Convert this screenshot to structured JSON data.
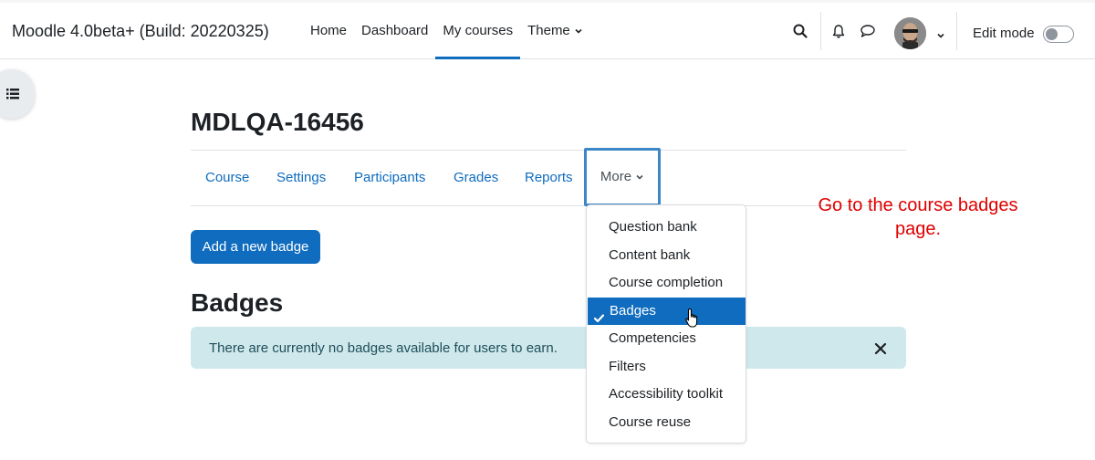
{
  "site": {
    "name": "Moodle 4.0beta+ (Build: 20220325)"
  },
  "primary_nav": [
    {
      "label": "Home",
      "active": false
    },
    {
      "label": "Dashboard",
      "active": false
    },
    {
      "label": "My courses",
      "active": true
    },
    {
      "label": "Theme",
      "active": false,
      "has_caret": true
    }
  ],
  "user_menu": {
    "edit_mode_label": "Edit mode",
    "edit_mode_on": false
  },
  "icons": {
    "search": "search-icon",
    "notifications": "bell-icon",
    "messages": "chat-bubble-icon",
    "drawer": "list-icon",
    "close": "close-icon"
  },
  "course": {
    "title": "MDLQA-16456",
    "nav": [
      "Course",
      "Settings",
      "Participants",
      "Grades",
      "Reports"
    ],
    "more_label": "More"
  },
  "more_menu": {
    "items": [
      {
        "label": "Question bank",
        "selected": false
      },
      {
        "label": "Content bank",
        "selected": false
      },
      {
        "label": "Course completion",
        "selected": false
      },
      {
        "label": "Badges",
        "selected": true
      },
      {
        "label": "Competencies",
        "selected": false
      },
      {
        "label": "Filters",
        "selected": false
      },
      {
        "label": "Accessibility toolkit",
        "selected": false
      },
      {
        "label": "Course reuse",
        "selected": false
      }
    ]
  },
  "annotation": {
    "line1": "Go to the course badges",
    "line2": "page."
  },
  "content": {
    "add_badge_label": "Add a new badge",
    "heading": "Badges",
    "alert_text": "There are currently no badges available for users to earn."
  },
  "colors": {
    "primary": "#0f6cbf",
    "alert_bg": "#cfe8eb",
    "annotation": "#e00000"
  }
}
